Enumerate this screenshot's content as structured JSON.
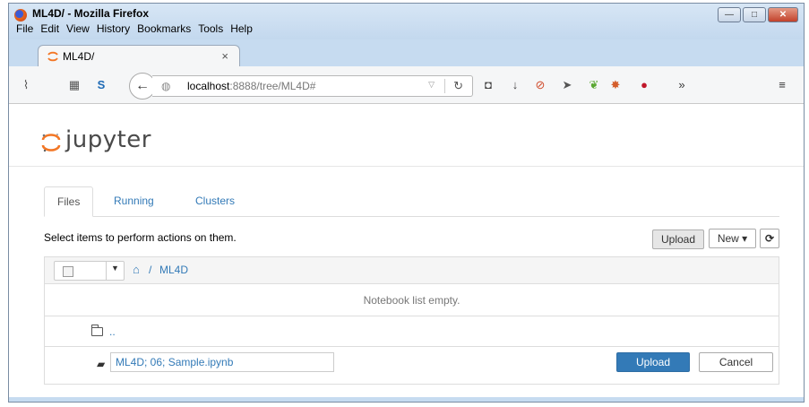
{
  "window": {
    "title": "ML4D/ - Mozilla Firefox",
    "controls": [
      "—",
      "□",
      "✕"
    ]
  },
  "menu": [
    "File",
    "Edit",
    "View",
    "History",
    "Bookmarks",
    "Tools",
    "Help"
  ],
  "tab": {
    "title": "ML4D/",
    "close": "×"
  },
  "url": {
    "host": "localhost",
    "rest": ":8888/tree/ML4D#"
  },
  "jupyter": {
    "logo_text": "jupyter"
  },
  "jtabs": [
    "Files",
    "Running",
    "Clusters"
  ],
  "toolbar": {
    "select_text": "Select items to perform actions on them.",
    "upload": "Upload",
    "new": "New ▾",
    "refresh": "⟳"
  },
  "breadcrumb": {
    "home": "⌂",
    "sep": "/",
    "folder": "ML4D"
  },
  "list": {
    "empty_text": "Notebook list empty.",
    "parent": "..",
    "upload_filename": "ML4D; 06; Sample.ipynb",
    "upload_button": "Upload",
    "cancel_button": "Cancel"
  },
  "colors": {
    "link": "#337ab7",
    "primary": "#337ab7",
    "chrome": "#c6dbf0"
  }
}
